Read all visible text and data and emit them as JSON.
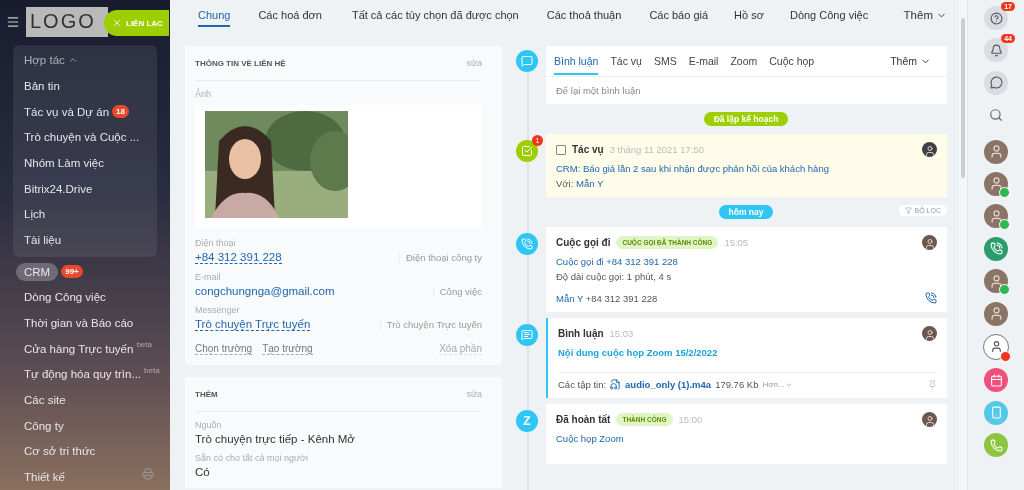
{
  "sidebar": {
    "logo": "LOGO",
    "contact_button": "LIÊN LẠC",
    "group": {
      "label": "Hợp tác",
      "expanded": true,
      "children": [
        {
          "label": "Bản tin",
          "selected": false
        },
        {
          "label": "Tác vụ và Dự án",
          "selected": false,
          "badge": "18"
        },
        {
          "label": "Trò chuyện và Cuộc ...",
          "selected": false
        },
        {
          "label": "Nhóm Làm việc",
          "selected": false
        },
        {
          "label": "Bitrix24.Drive",
          "selected": false
        },
        {
          "label": "Lịch",
          "selected": false
        },
        {
          "label": "Tài liệu",
          "selected": false
        }
      ]
    },
    "items": [
      {
        "label": "CRM",
        "selected": true,
        "badge": "99+"
      },
      {
        "label": "Dòng Công việc",
        "selected": false
      },
      {
        "label": "Thời gian và Báo cáo",
        "selected": false
      },
      {
        "label": "Cửa hàng Trực tuyến",
        "selected": false,
        "sup": "beta"
      },
      {
        "label": "Tự động hóa quy trìn...",
        "selected": false,
        "sup": "beta"
      },
      {
        "label": "Các site",
        "selected": false
      },
      {
        "label": "Công ty",
        "selected": false
      },
      {
        "label": "Cơ sở tri thức",
        "selected": false
      },
      {
        "label": "Thiết kế",
        "selected": false
      }
    ]
  },
  "tabs": [
    {
      "label": "Chung",
      "selected": true
    },
    {
      "label": "Các hoá đơn",
      "selected": false
    },
    {
      "label": "Tất cả các tùy chọn đã được chọn",
      "selected": false
    },
    {
      "label": "Các thoả thuận",
      "selected": false
    },
    {
      "label": "Các báo giá",
      "selected": false
    },
    {
      "label": "Hồ sơ",
      "selected": false
    },
    {
      "label": "Dòng Công việc",
      "selected": false
    }
  ],
  "tabs_more": "Thêm",
  "contact_card": {
    "title": "THÔNG TIN VỀ LIÊN HỆ",
    "edit": "sửa",
    "photo_label": "Ảnh",
    "fields": [
      {
        "label": "Điện thoại",
        "value": "+84 312 391 228",
        "type": "Điện thoại công ty"
      },
      {
        "label": "E-mail",
        "value": "congchungnga@gmail.com",
        "type": "Công việc"
      },
      {
        "label": "Messenger",
        "value": "Trò chuyện Trực tuyến",
        "type": "Trò chuyện Trực tuyến"
      }
    ],
    "actions": [
      "Chọn trường",
      "Tạo trường"
    ],
    "remove": {
      "label": "Xóa phần",
      "disabled": true
    }
  },
  "extra_card": {
    "title": "THÊM",
    "edit": "sửa",
    "fields": [
      {
        "label": "Nguồn",
        "value": "Trò chuyện trực tiếp - Kênh Mở"
      },
      {
        "label": "Sẵn có cho tất cả mọi người",
        "value": "Có"
      }
    ]
  },
  "composer": {
    "tabs": [
      {
        "label": "Bình luận",
        "selected": true
      },
      {
        "label": "Tác vụ",
        "selected": false
      },
      {
        "label": "SMS",
        "selected": false
      },
      {
        "label": "E-mail",
        "selected": false
      },
      {
        "label": "Zoom",
        "selected": false
      },
      {
        "label": "Cuộc họp",
        "selected": false
      }
    ],
    "more": "Thêm",
    "placeholder": "Để lại một bình luận"
  },
  "timeline": [
    {
      "kind": "divider",
      "label": "Đã lập kế hoạch",
      "color": "#9dcf00"
    },
    {
      "kind": "task",
      "badge": "1",
      "checked": false,
      "title": "Tác vụ",
      "time": "3 tháng 11 2021 17:50",
      "link": "CRM: Báo giá lần 2 sau khi nhận được phản hồi của khách hàng",
      "with_label": "Với:",
      "with": "Mẫn Y"
    },
    {
      "kind": "divider",
      "label": "hôm nay",
      "color": "#2fc6f6",
      "filter": "BỘ LỌC"
    },
    {
      "kind": "call",
      "title": "Cuộc gọi đi",
      "tag": "CUỘC GỌI ĐÃ THÀNH CÔNG",
      "time": "15:05",
      "link": "Cuộc gọi đi +84 312 391 228",
      "detail": "Độ dài cuộc gọi: 1 phút, 4 s",
      "contact": "Mẫn Y",
      "phone": "+84 312 391 228"
    },
    {
      "kind": "comment",
      "title": "Bình luận",
      "time": "15:03",
      "text": "Nội dung cuộc họp Zoom 15/2/2022",
      "files_label": "Các tập tin:",
      "file": "audio_only (1).m4a",
      "size": "179.76 Kb",
      "more": "Hơn..."
    },
    {
      "kind": "zoom",
      "icon_text": "Z",
      "title": "Đã hoàn tất",
      "tag": "THÀNH CÔNG",
      "time": "15:00",
      "link": "Cuộc họp Zoom"
    }
  ],
  "right_bar": [
    {
      "kind": "help",
      "badge": "17"
    },
    {
      "kind": "notifications",
      "badge": "44"
    },
    {
      "kind": "chat"
    },
    {
      "kind": "search"
    },
    {
      "kind": "avatar",
      "online": false
    },
    {
      "kind": "avatar",
      "online": true
    },
    {
      "kind": "avatar",
      "online": true
    },
    {
      "kind": "call"
    },
    {
      "kind": "avatar",
      "online": true
    },
    {
      "kind": "avatar",
      "online": false
    },
    {
      "kind": "bot"
    },
    {
      "kind": "calendar"
    },
    {
      "kind": "phone-cloud"
    },
    {
      "kind": "phone"
    }
  ]
}
